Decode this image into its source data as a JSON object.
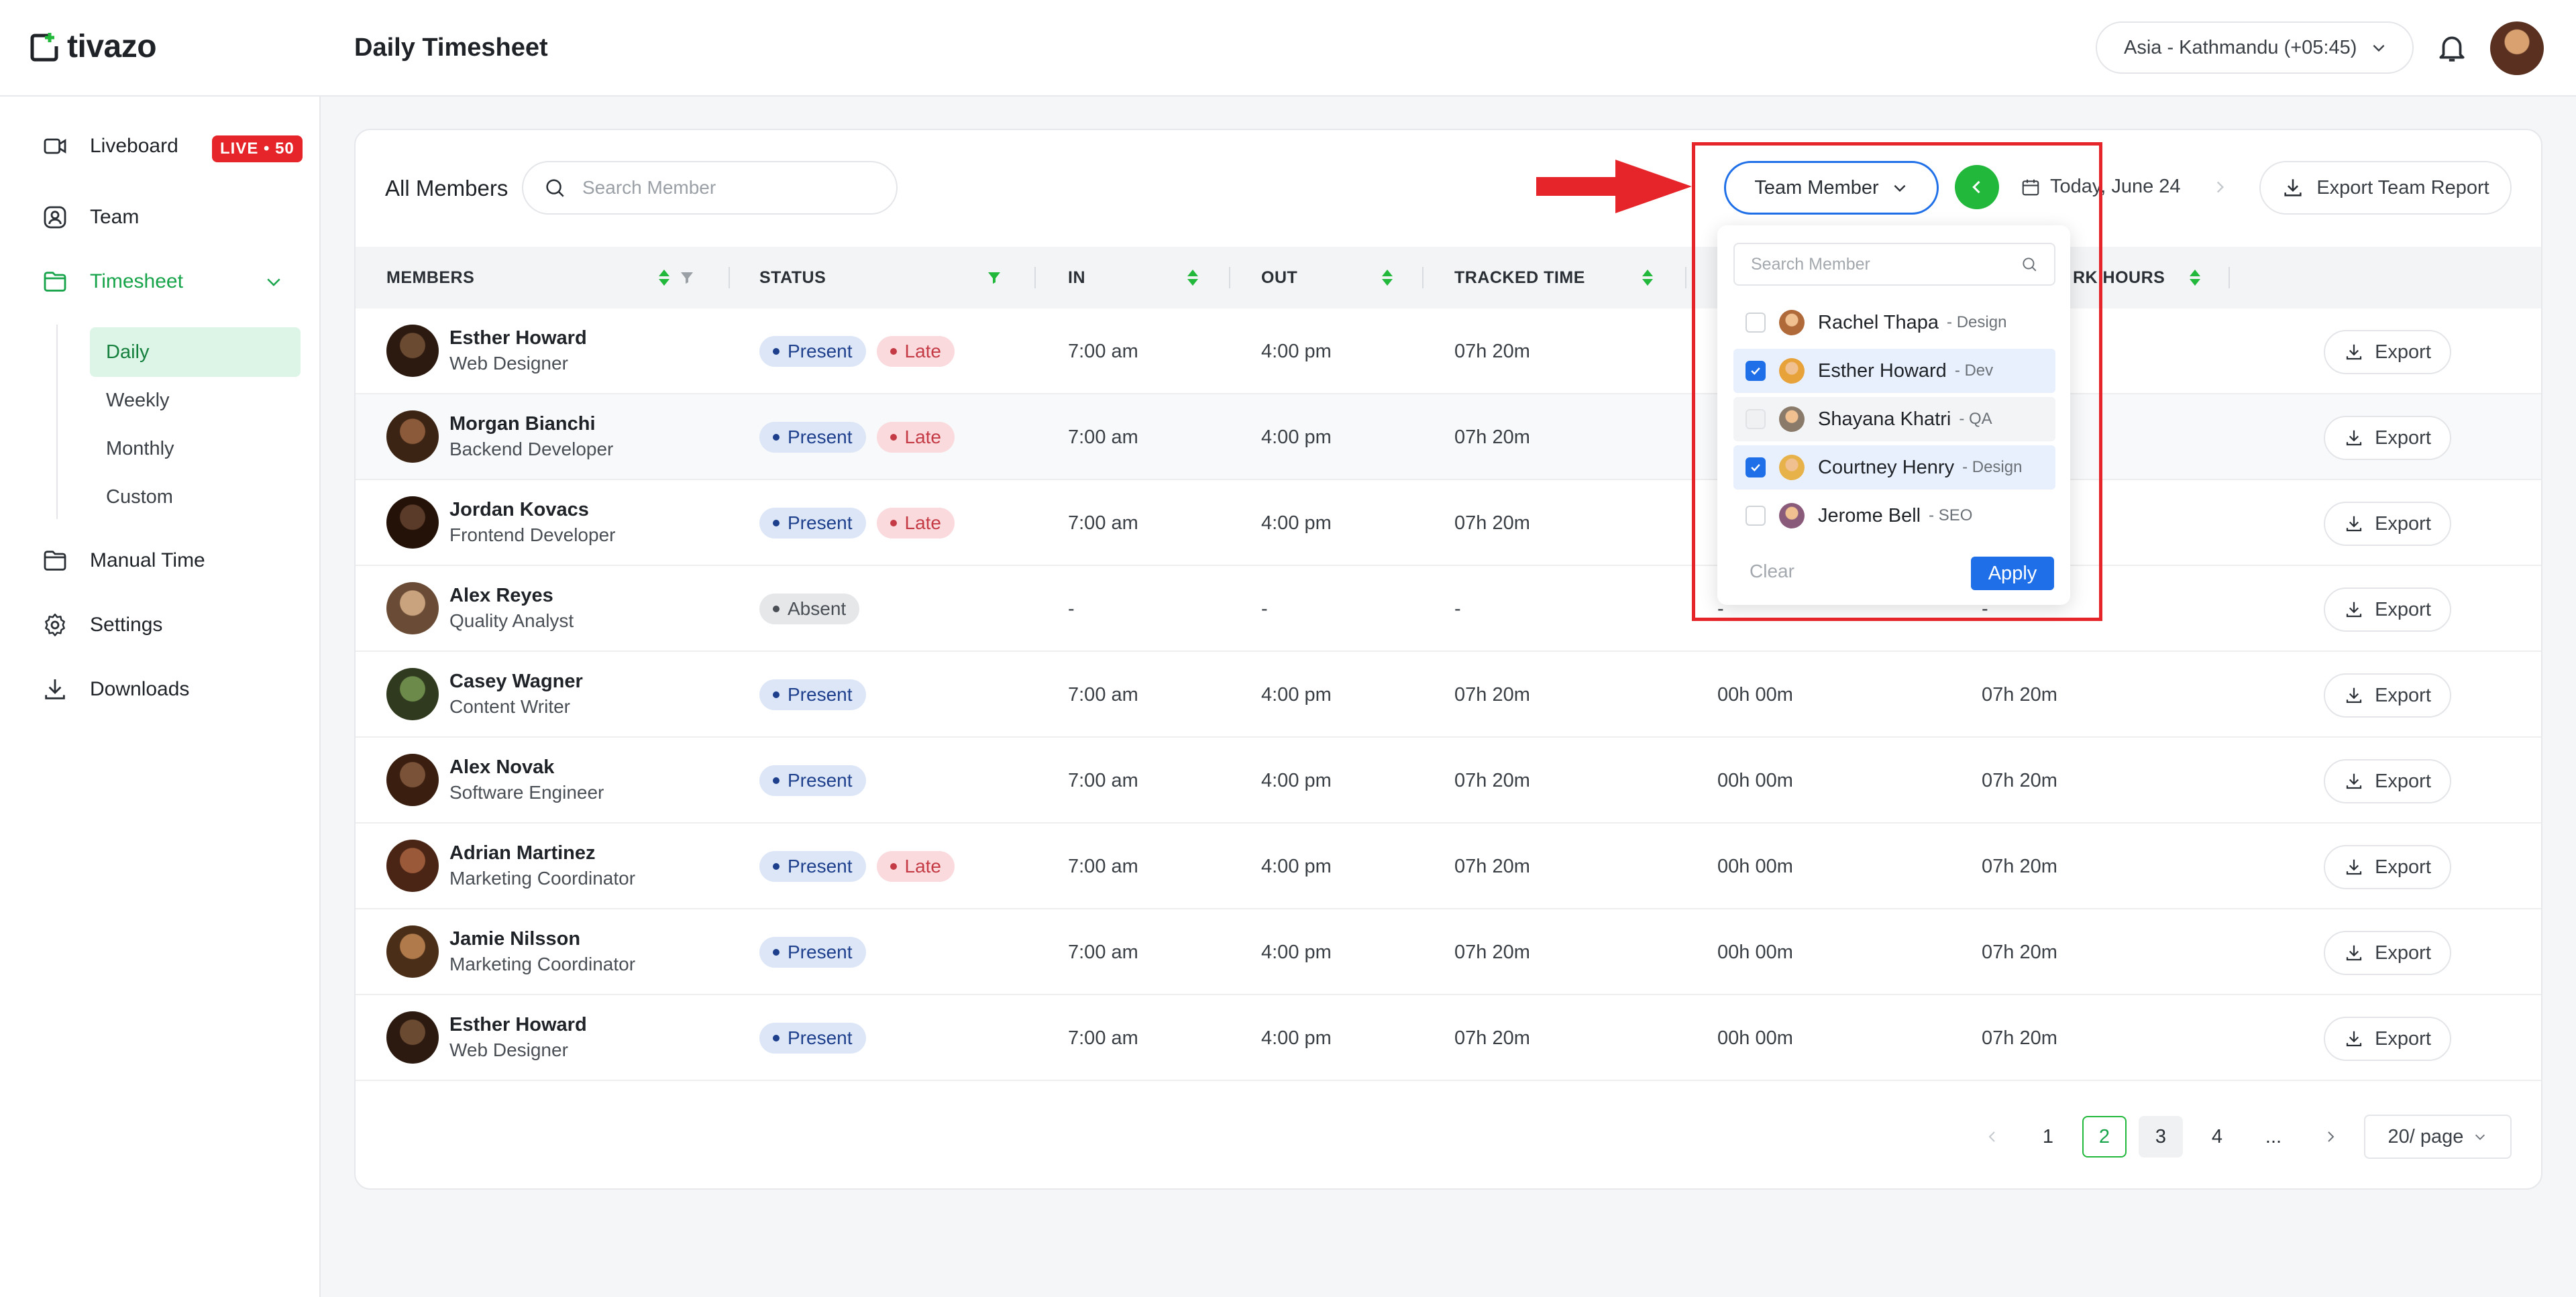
{
  "app": {
    "name": "tivazo",
    "page_title": "Daily Timesheet",
    "timezone": "Asia - Kathmandu (+05:45)"
  },
  "colors": {
    "brand_green": "#16a34a",
    "accent_blue": "#1e6fe8",
    "live_red": "#e5252a"
  },
  "sidebar": {
    "items": [
      {
        "label": "Liveboard",
        "icon": "liveboard-icon",
        "badge": "LIVE • 50"
      },
      {
        "label": "Team",
        "icon": "team-icon"
      },
      {
        "label": "Timesheet",
        "icon": "timesheet-icon",
        "expanded": true
      },
      {
        "label": "Manual Time",
        "icon": "manual-time-icon"
      },
      {
        "label": "Settings",
        "icon": "gear-icon"
      },
      {
        "label": "Downloads",
        "icon": "download-icon"
      }
    ],
    "timesheet_sub": [
      "Daily",
      "Weekly",
      "Monthly",
      "Custom"
    ]
  },
  "toolbar": {
    "all_members": "All Members",
    "search_placeholder": "Search Member",
    "team_member_label": "Team Member",
    "date_label": "Today, June 24",
    "export_team_label": "Export Team Report"
  },
  "table": {
    "columns": [
      "MEMBERS",
      "STATUS",
      "IN",
      "OUT",
      "TRACKED TIME",
      "RK HOURS"
    ],
    "export_label": "Export",
    "rows": [
      {
        "name": "Esther Howard",
        "role": "Web Designer",
        "status": [
          "Present",
          "Late"
        ],
        "in": "7:00 am",
        "out": "4:00 pm",
        "tracked": "07h 20m",
        "idle": "",
        "work": ""
      },
      {
        "name": "Morgan Bianchi",
        "role": "Backend Developer",
        "status": [
          "Present",
          "Late"
        ],
        "in": "7:00 am",
        "out": "4:00 pm",
        "tracked": "07h 20m",
        "idle": "",
        "work": ""
      },
      {
        "name": "Jordan Kovacs",
        "role": "Frontend Developer",
        "status": [
          "Present",
          "Late"
        ],
        "in": "7:00 am",
        "out": "4:00 pm",
        "tracked": "07h 20m",
        "idle": "",
        "work": ""
      },
      {
        "name": "Alex Reyes",
        "role": "Quality Analyst",
        "status": [
          "Absent"
        ],
        "in": "-",
        "out": "-",
        "tracked": "-",
        "idle": "-",
        "work": "-"
      },
      {
        "name": "Casey Wagner",
        "role": "Content Writer",
        "status": [
          "Present"
        ],
        "in": "7:00 am",
        "out": "4:00 pm",
        "tracked": "07h 20m",
        "idle": "00h 00m",
        "work": "07h 20m"
      },
      {
        "name": "Alex Novak",
        "role": "Software Engineer",
        "status": [
          "Present"
        ],
        "in": "7:00 am",
        "out": "4:00 pm",
        "tracked": "07h 20m",
        "idle": "00h 00m",
        "work": "07h 20m"
      },
      {
        "name": "Adrian Martinez",
        "role": "Marketing Coordinator",
        "status": [
          "Present",
          "Late"
        ],
        "in": "7:00 am",
        "out": "4:00 pm",
        "tracked": "07h 20m",
        "idle": "00h 00m",
        "work": "07h 20m"
      },
      {
        "name": "Jamie Nilsson",
        "role": "Marketing Coordinator",
        "status": [
          "Present"
        ],
        "in": "7:00 am",
        "out": "4:00 pm",
        "tracked": "07h 20m",
        "idle": "00h 00m",
        "work": "07h 20m"
      },
      {
        "name": "Esther Howard",
        "role": "Web Designer",
        "status": [
          "Present"
        ],
        "in": "7:00 am",
        "out": "4:00 pm",
        "tracked": "07h 20m",
        "idle": "00h 00m",
        "work": "07h 20m"
      }
    ]
  },
  "dropdown": {
    "search_placeholder": "Search Member",
    "items": [
      {
        "name": "Rachel Thapa",
        "role": "- Design",
        "checked": false
      },
      {
        "name": "Esther Howard",
        "role": "- Dev",
        "checked": true
      },
      {
        "name": "Shayana Khatri",
        "role": "- QA",
        "checked": false
      },
      {
        "name": "Courtney Henry",
        "role": "- Design",
        "checked": true
      },
      {
        "name": "Jerome Bell",
        "role": "- SEO",
        "checked": false
      }
    ],
    "clear_label": "Clear",
    "apply_label": "Apply"
  },
  "pagination": {
    "pages": [
      "1",
      "2",
      "3",
      "4",
      "..."
    ],
    "current": "2",
    "per_page": "20/ page"
  }
}
